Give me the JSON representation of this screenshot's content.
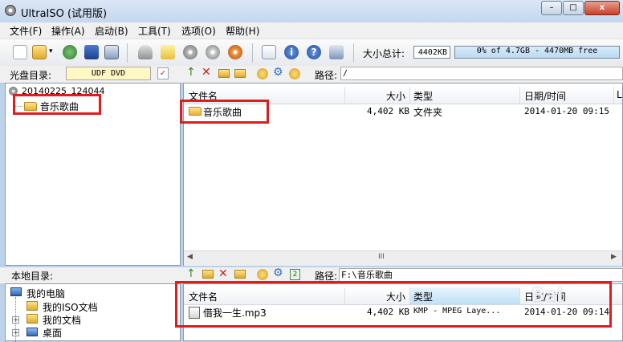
{
  "window": {
    "title": "UltraISO (试用版)"
  },
  "window_buttons": {
    "minimize": "–",
    "maximize": "□",
    "close": "x"
  },
  "menu": [
    {
      "label": "文件(F)"
    },
    {
      "label": "操作(A)"
    },
    {
      "label": "启动(B)"
    },
    {
      "label": "工具(T)"
    },
    {
      "label": "选项(O)"
    },
    {
      "label": "帮助(H)"
    }
  ],
  "toolbar": {
    "total_size_label": "大小总计:",
    "total_size_value": "4402KB",
    "capacity_text": "0% of 4.7GB - 4470MB free",
    "capacity_fraction": 0.0
  },
  "disc": {
    "label": "光盘目录:",
    "name": "UDF DVD",
    "path_label": "路径:",
    "path": "/",
    "tree_root": "20140225_124044",
    "tree_children": [
      {
        "label": "音乐歌曲"
      }
    ]
  },
  "disc_columns": {
    "name": "文件名",
    "size": "大小",
    "type": "类型",
    "date": "日期/时间",
    "extra": "L"
  },
  "disc_files": [
    {
      "name": "音乐歌曲",
      "size": "4,402 KB",
      "type": "文件夹",
      "date": "2014-01-20 09:15"
    }
  ],
  "local": {
    "label": "本地目录:",
    "path_label": "路径:",
    "path": "F:\\音乐歌曲",
    "tree": [
      {
        "label": "我的电脑"
      },
      {
        "label": "我的ISO文档"
      },
      {
        "label": "我的文档"
      },
      {
        "label": "桌面"
      }
    ]
  },
  "local_columns": {
    "name": "文件名",
    "size": "大小",
    "type": "类型",
    "date": "日期/时间"
  },
  "local_files": [
    {
      "name": "借我一生.mp3",
      "size": "4,402 KB",
      "type": "KMP - MPEG Laye...",
      "date": "2014-01-20 09:14"
    }
  ],
  "scroll_glyph": "III",
  "watermark": "Bai"
}
